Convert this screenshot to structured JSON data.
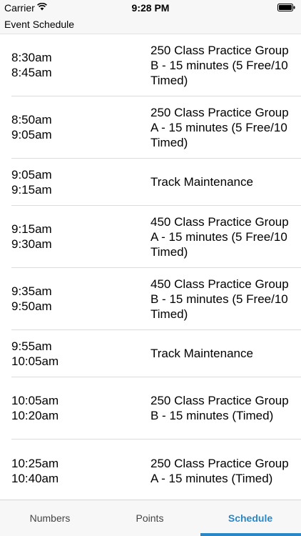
{
  "status_bar": {
    "carrier": "Carrier",
    "time": "9:28 PM"
  },
  "header": {
    "title": "Event Schedule"
  },
  "schedule": [
    {
      "start": "8:30am",
      "end": "8:45am",
      "description": "250 Class Practice Group B - 15 minutes (5 Free/10 Timed)"
    },
    {
      "start": "8:50am",
      "end": "9:05am",
      "description": "250 Class Practice Group A - 15 minutes (5 Free/10 Timed)"
    },
    {
      "start": "9:05am",
      "end": "9:15am",
      "description": "Track Maintenance"
    },
    {
      "start": "9:15am",
      "end": "9:30am",
      "description": "450 Class Practice Group A - 15 minutes (5 Free/10 Timed)"
    },
    {
      "start": "9:35am",
      "end": "9:50am",
      "description": "450 Class Practice Group B - 15 minutes (5 Free/10 Timed)"
    },
    {
      "start": "9:55am",
      "end": "10:05am",
      "description": "Track Maintenance"
    },
    {
      "start": "10:05am",
      "end": "10:20am",
      "description": "250 Class Practice Group B - 15 minutes (Timed)"
    },
    {
      "start": "10:25am",
      "end": "10:40am",
      "description": "250 Class Practice Group A - 15 minutes (Timed)"
    }
  ],
  "tabs": [
    {
      "label": "Numbers",
      "active": false
    },
    {
      "label": "Points",
      "active": false
    },
    {
      "label": "Schedule",
      "active": true
    }
  ],
  "colors": {
    "accent": "#2a87c6"
  }
}
